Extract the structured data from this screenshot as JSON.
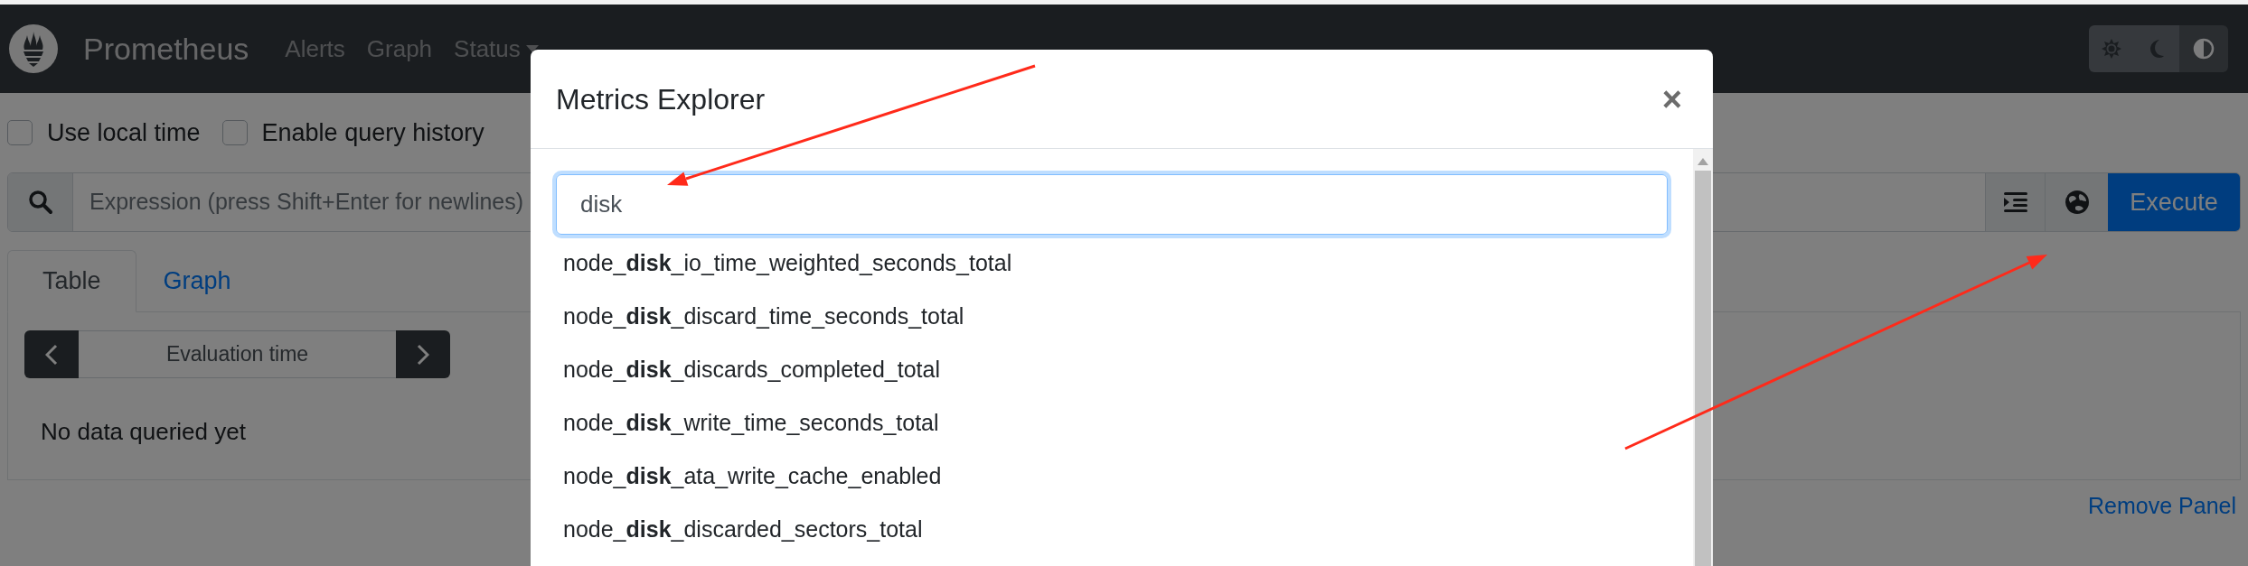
{
  "navbar": {
    "brand": "Prometheus",
    "links": [
      {
        "label": "Alerts",
        "dropdown": false
      },
      {
        "label": "Graph",
        "dropdown": false
      },
      {
        "label": "Status",
        "dropdown": true
      }
    ],
    "theme_toggle": [
      {
        "kind": "light",
        "selected": false
      },
      {
        "kind": "dark",
        "selected": false
      },
      {
        "kind": "auto",
        "selected": true
      }
    ]
  },
  "options": [
    {
      "label": "Use local time",
      "checked": false
    },
    {
      "label": "Enable query history",
      "checked": false
    }
  ],
  "expression": {
    "placeholder": "Expression (press Shift+Enter for newlines)",
    "execute": "Execute"
  },
  "panel": {
    "tabs": [
      {
        "label": "Table",
        "selected": true
      },
      {
        "label": "Graph",
        "selected": false
      }
    ],
    "evaluation_time": {
      "placeholder": "Evaluation time"
    },
    "empty_message": "No data queried yet",
    "remove": "Remove Panel"
  },
  "modal": {
    "title": "Metrics Explorer",
    "close": "×",
    "search": {
      "value": "disk"
    },
    "results": [
      "node_**disk**_io_time_weighted_seconds_total",
      "node_**disk**_discard_time_seconds_total",
      "node_**disk**_discards_completed_total",
      "node_**disk**_write_time_seconds_total",
      "node_**disk**_ata_write_cache_enabled",
      "node_**disk**_discarded_sectors_total"
    ]
  }
}
